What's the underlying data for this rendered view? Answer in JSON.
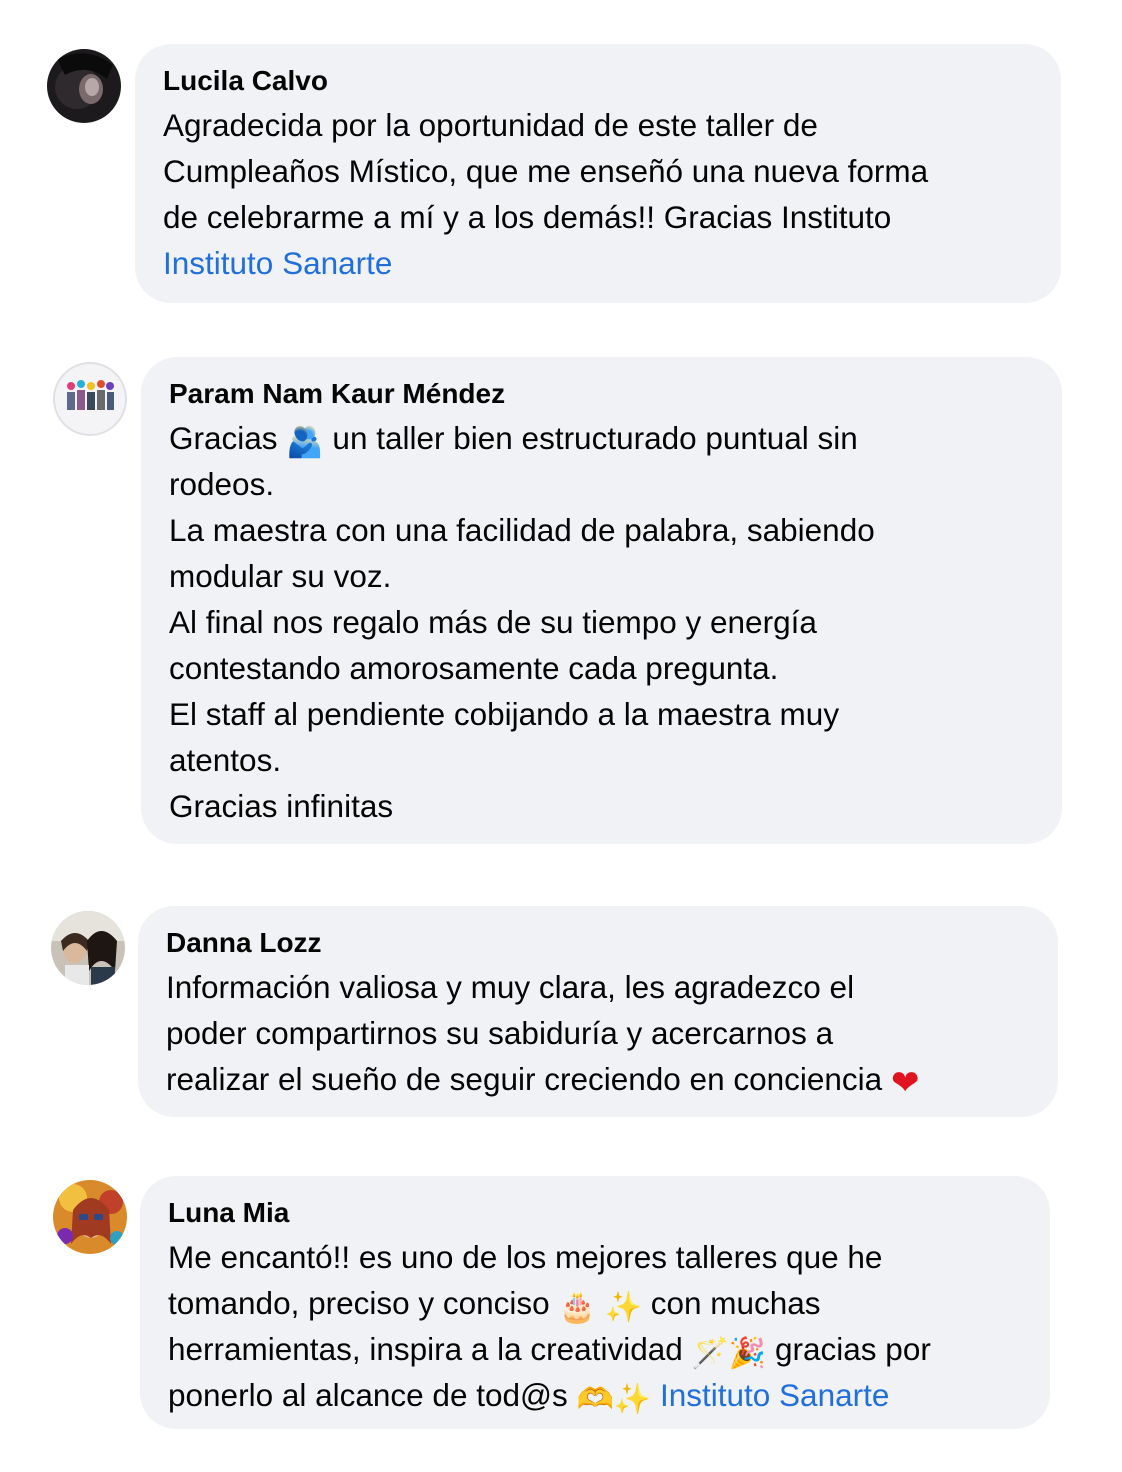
{
  "comments": [
    {
      "author": "Lucila Calvo",
      "lines": [
        {
          "text": "Agradecida por la oportunidad de este taller de"
        },
        {
          "text": "Cumpleaños Místico, que me enseñó una nueva forma"
        },
        {
          "text": "de celebrarme a mí y a los demás!! Gracias Instituto"
        }
      ],
      "mention": "Instituto Sanarte",
      "avatar_icon": "profile-photo-dark"
    },
    {
      "author": "Param Nam Kaur Méndez",
      "line1_before": "Gracias",
      "line1_emoji": "🫂",
      "line1_after": "un taller bien estructurado puntual sin",
      "lines": [
        {
          "text": "rodeos."
        },
        {
          "text": "La maestra con una facilidad de palabra, sabiendo"
        },
        {
          "text": "modular su voz."
        },
        {
          "text": "Al final nos regalo más de su tiempo y energía"
        },
        {
          "text": "contestando amorosamente cada pregunta."
        },
        {
          "text": "El staff al pendiente cobijando a la maestra muy"
        },
        {
          "text": "atentos."
        },
        {
          "text": "Gracias infinitas"
        }
      ],
      "avatar_icon": "profile-photo-group"
    },
    {
      "author": "Danna Lozz",
      "lines": [
        {
          "text": "Información valiosa y muy clara, les agradezco el"
        },
        {
          "text": "poder compartirnos su sabiduría y acercarnos a"
        },
        {
          "text": "realizar el sueño de seguir creciendo en conciencia"
        }
      ],
      "end_emoji": "❤",
      "avatar_icon": "profile-photo-duo"
    },
    {
      "author": "Luna Mia",
      "line1": "Me encantó!! es uno de los mejores talleres que he",
      "line2_before": "tomando, preciso y conciso",
      "line2_emoji1": "🎂",
      "line2_emoji2": "✨",
      "line2_after": "con muchas",
      "line3_before": "herramientas, inspira a la creatividad",
      "line3_emoji1": "🪄",
      "line3_emoji2": "🎉",
      "line3_after": "gracias por",
      "line4_before": "ponerlo al alcance de tod@s",
      "line4_emoji1": "🫶",
      "line4_emoji2": "✨",
      "mention": "Instituto Sanarte",
      "avatar_icon": "profile-photo-colorful"
    }
  ],
  "colors": {
    "bubble": "#f0f2f5",
    "mention": "#216fdb",
    "text": "#050505"
  }
}
